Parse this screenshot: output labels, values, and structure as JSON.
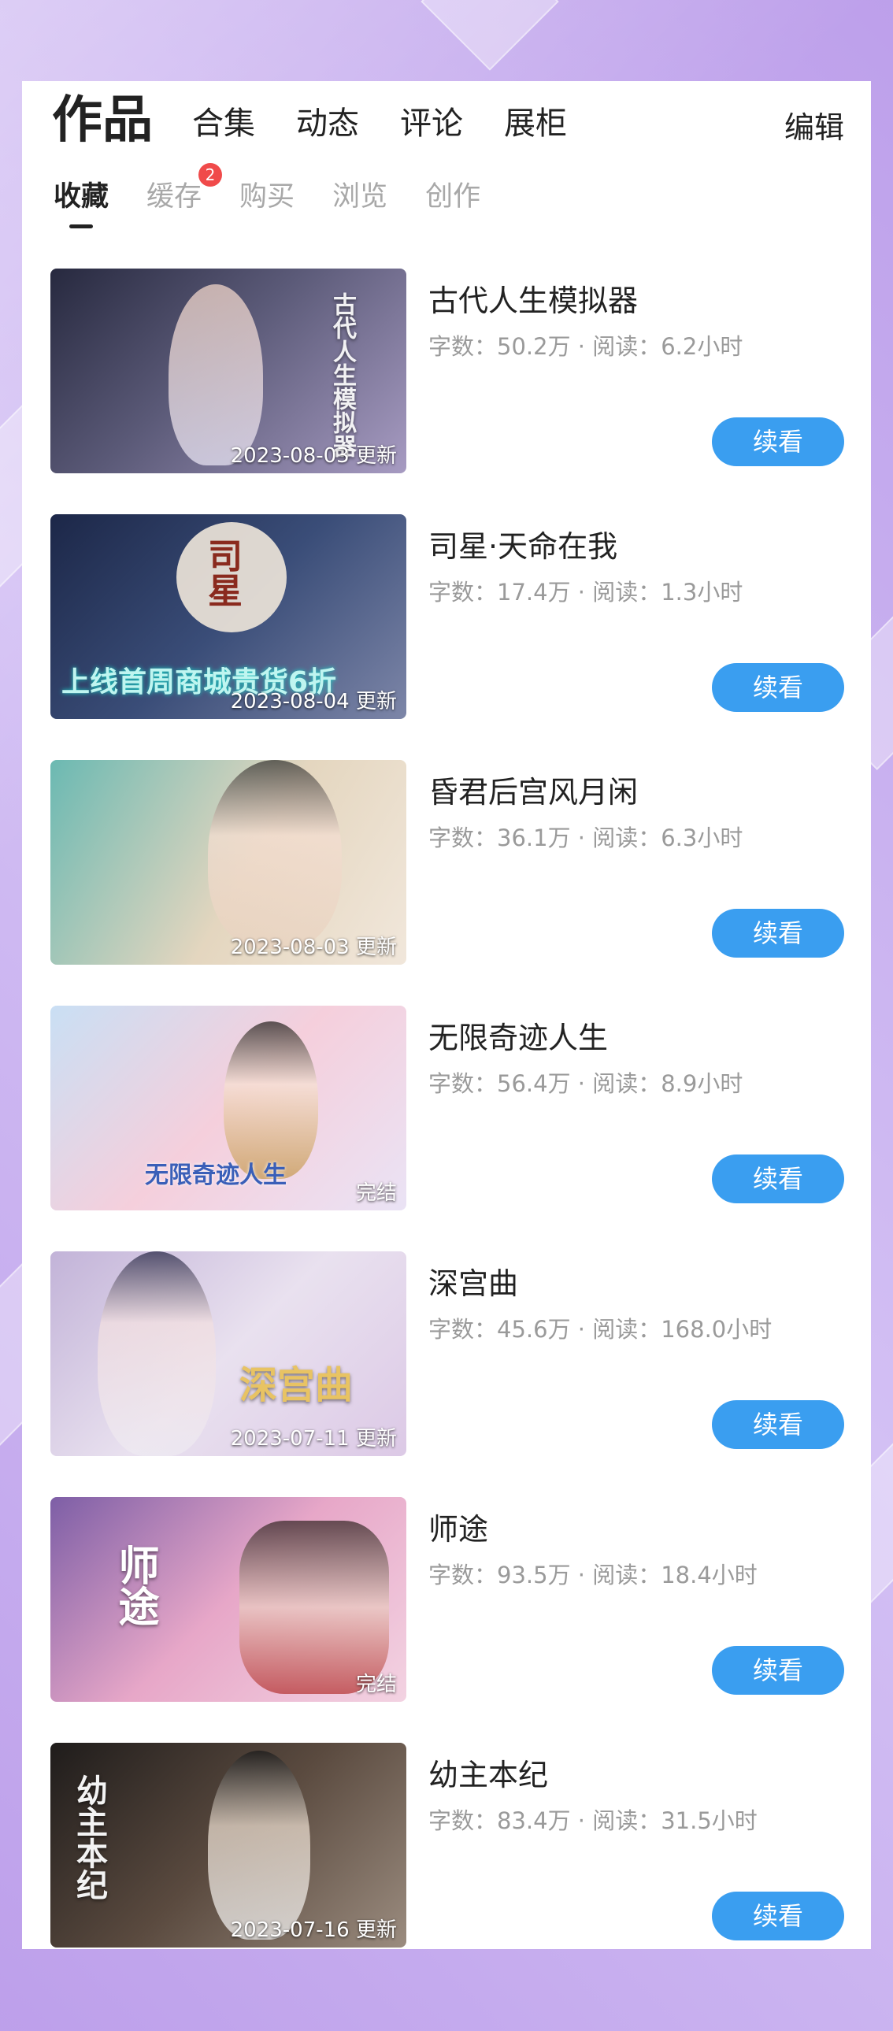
{
  "top_tabs": [
    "作品",
    "合集",
    "动态",
    "评论",
    "展柜"
  ],
  "edit_label": "编辑",
  "sub_tabs": [
    "收藏",
    "缓存",
    "购买",
    "浏览",
    "创作"
  ],
  "cache_badge": "2",
  "continue_label": "续看",
  "books": [
    {
      "title": "古代人生模拟器",
      "meta": "字数：50.2万 · 阅读：6.2小时",
      "cover_caption": "2023-08-03 更新",
      "cover_text": "古代人生模拟器",
      "colors": [
        "#27293f",
        "#5b5a78",
        "#a79bc2"
      ]
    },
    {
      "title": "司星·天命在我",
      "meta": "字数：17.4万 · 阅读：1.3小时",
      "cover_caption": "2023-08-04 更新",
      "cover_text": "司星",
      "cover_promo": "上线首周商城贵货6折",
      "colors": [
        "#1c2748",
        "#3a4d78",
        "#7d86a8"
      ]
    },
    {
      "title": "昏君后宫风月闲",
      "meta": "字数：36.1万 · 阅读：6.3小时",
      "cover_caption": "2023-08-03 更新",
      "colors": [
        "#6bb9b2",
        "#e4d6bf",
        "#f1e7db"
      ]
    },
    {
      "title": "无限奇迹人生",
      "meta": "字数：56.4万 · 阅读：8.9小时",
      "cover_caption": "完结",
      "cover_text": "无限奇迹人生",
      "colors": [
        "#c9dff4",
        "#f5cfdc",
        "#eae3f5"
      ]
    },
    {
      "title": "深宫曲",
      "meta": "字数：45.6万 · 阅读：168.0小时",
      "cover_caption": "2023-07-11 更新",
      "cover_text": "深宫曲",
      "colors": [
        "#c2b3d8",
        "#e9e1ef",
        "#dcc9e6"
      ]
    },
    {
      "title": "师途",
      "meta": "字数：93.5万 · 阅读：18.4小时",
      "cover_caption": "完结",
      "cover_text": "师途",
      "colors": [
        "#7d5ea6",
        "#e7a7c8",
        "#f3d3e2"
      ]
    },
    {
      "title": "幼主本纪",
      "meta": "字数：83.4万 · 阅读：31.5小时",
      "cover_caption": "2023-07-16 更新",
      "cover_text": "幼主本纪",
      "colors": [
        "#1f1c1b",
        "#5a4a3f",
        "#9b8c7f"
      ]
    }
  ],
  "accent_color": "#3a9ef0",
  "badge_color": "#f04a4a"
}
